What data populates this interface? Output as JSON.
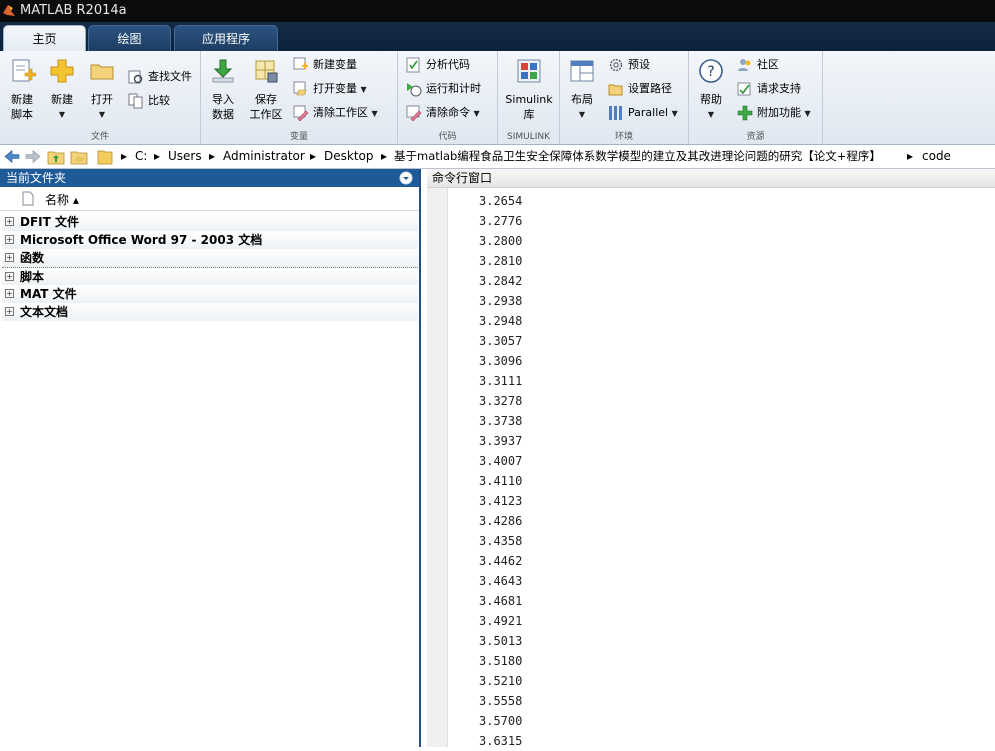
{
  "window": {
    "title": "MATLAB R2014a"
  },
  "tabs": [
    {
      "label": "主页"
    },
    {
      "label": "绘图"
    },
    {
      "label": "应用程序"
    }
  ],
  "ribbon": {
    "file": {
      "label": "文件",
      "new_script": "新建\n脚本",
      "new": "新建",
      "open": "打开",
      "find_files": "查找文件",
      "compare": "比较"
    },
    "variable": {
      "label": "变量",
      "import_data": "导入\n数据",
      "save_workspace": "保存\n工作区",
      "new_variable": "新建变量",
      "open_variable": "打开变量",
      "clear_workspace": "清除工作区"
    },
    "code": {
      "label": "代码",
      "analyze_code": "分析代码",
      "run_and_time": "运行和计时",
      "clear_commands": "清除命令"
    },
    "simulink": {
      "label": "SIMULINK",
      "library": "Simulink\n库"
    },
    "environment": {
      "label": "环境",
      "layout": "布局",
      "preferences": "预设",
      "set_path": "设置路径",
      "parallel": "Parallel"
    },
    "resources": {
      "label": "资源",
      "help": "帮助",
      "community": "社区",
      "request_support": "请求支持",
      "add_ons": "附加功能"
    }
  },
  "address": {
    "crumbs": [
      "C:",
      "Users",
      "Administrator",
      "Desktop",
      "基于matlab编程食品卫生安全保障体系数学模型的建立及其改进理论问题的研究【论文+程序】",
      "code"
    ]
  },
  "current_folder": {
    "title": "当前文件夹",
    "column_name": "名称 ▴",
    "groups": [
      "DFIT 文件",
      "Microsoft Office Word 97 - 2003 文档",
      "函数",
      "脚本",
      "MAT 文件",
      "文本文档"
    ]
  },
  "command_window": {
    "title": "命令行窗口",
    "output": [
      "3.2654",
      "3.2776",
      "3.2800",
      "3.2810",
      "3.2842",
      "3.2938",
      "3.2948",
      "3.3057",
      "3.3096",
      "3.3111",
      "3.3278",
      "3.3738",
      "3.3937",
      "3.4007",
      "3.4110",
      "3.4123",
      "3.4286",
      "3.4358",
      "3.4462",
      "3.4643",
      "3.4681",
      "3.4921",
      "3.5013",
      "3.5180",
      "3.5210",
      "3.5558",
      "3.5700",
      "3.6315"
    ]
  },
  "colors": {
    "titlebar": "#0c0c0e",
    "tab_bar": "#142a46",
    "panel_header": "#1f5a98",
    "ribbon": "#e6edf4"
  }
}
